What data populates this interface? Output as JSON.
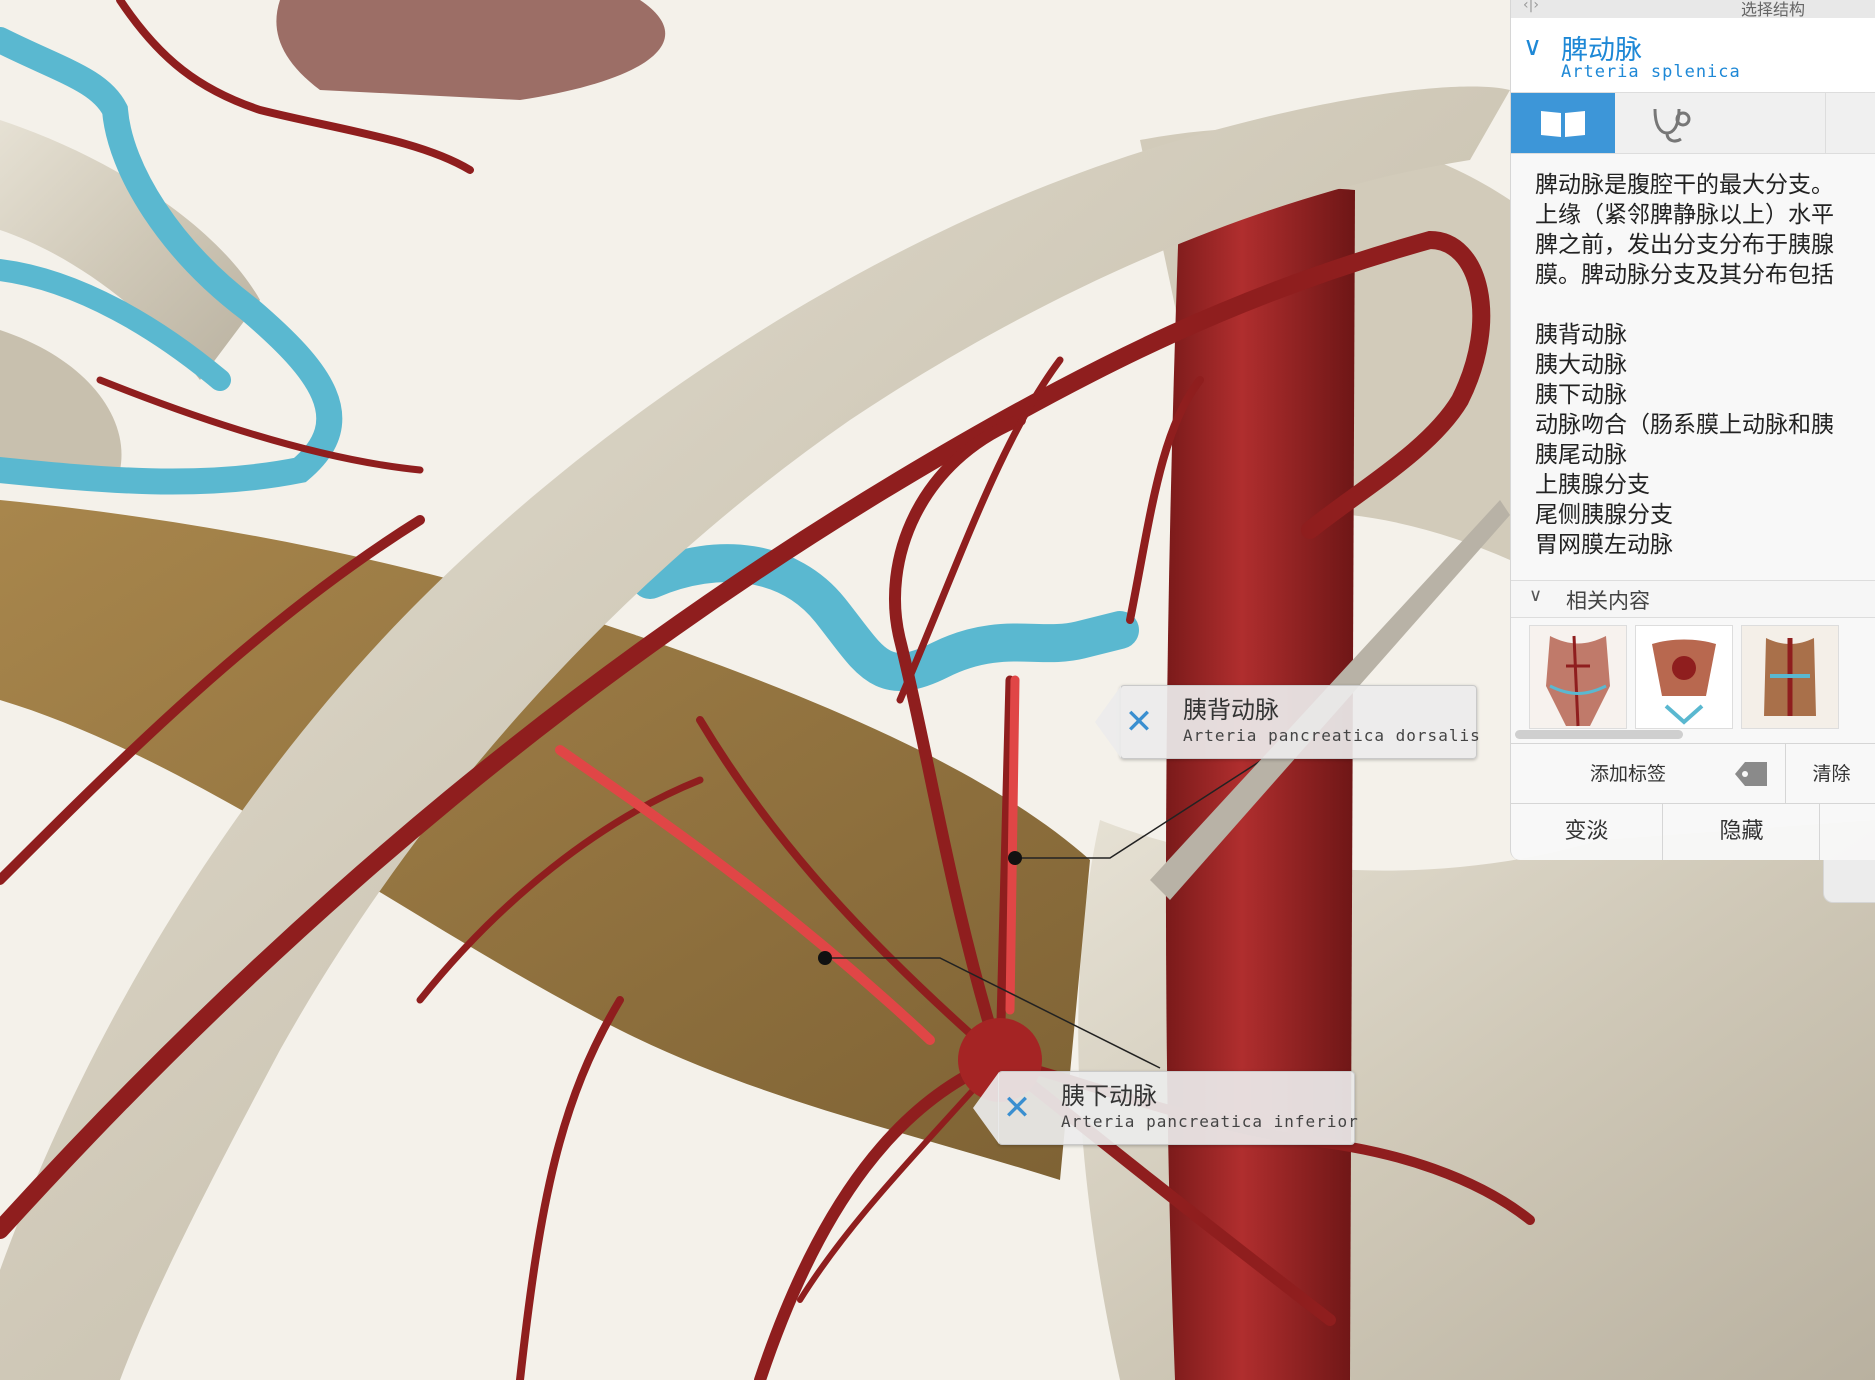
{
  "callouts": [
    {
      "chinese": "胰背动脉",
      "latin": "Arteria pancreatica dorsalis"
    },
    {
      "chinese": "胰下动脉",
      "latin": "Arteria pancreatica inferior"
    }
  ],
  "panel": {
    "header_nav": "‹|›",
    "header_title": "选择结构",
    "structure": {
      "chinese": "脾动脉",
      "latin": "Arteria splenica"
    },
    "tabs": [
      {
        "icon": "book-icon",
        "active": true
      },
      {
        "icon": "stethoscope-icon",
        "active": false
      }
    ],
    "description_lines": [
      "脾动脉是腹腔干的最大分支。",
      "上缘（紧邻脾静脉以上）水平",
      "脾之前，发出分支分布于胰腺",
      "膜。脾动脉分支及其分布包括"
    ],
    "branches": [
      "胰背动脉",
      "胰大动脉",
      "胰下动脉",
      "动脉吻合（肠系膜上动脉和胰",
      "胰尾动脉",
      "上胰腺分支",
      "尾侧胰腺分支",
      "胃网膜左动脉"
    ],
    "related_title": "相关内容",
    "related_items": [
      "related-anatomy-thumb",
      "related-anatomy-thumb",
      "related-anatomy-thumb"
    ],
    "actions": {
      "add_tag": "添加标签",
      "clear": "清除",
      "fade": "变淡",
      "hide": "隐藏"
    }
  },
  "colors": {
    "artery": "#8f1e1e",
    "artery_highlight": "#e04646",
    "vein": "#5ab8d0",
    "bone": "#d8d2c3",
    "pancreas": "#9a7a44",
    "accent": "#3d96d8"
  }
}
